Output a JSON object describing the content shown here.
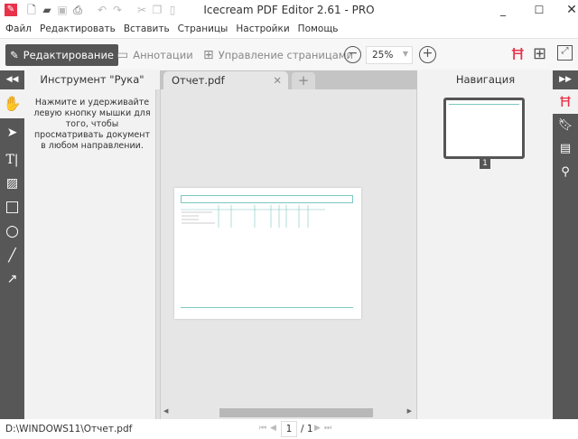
{
  "app": {
    "title": "Icecream PDF Editor 2.61 - PRO",
    "accent": "#e8334a"
  },
  "menu": [
    "Файл",
    "Редактировать",
    "Вставить",
    "Страницы",
    "Настройки",
    "Помощь"
  ],
  "toolbar": {
    "edit": "Редактирование",
    "annot": "Аннотации",
    "pages": "Управление страницами",
    "zoom": "25%"
  },
  "left_panel": {
    "title": "Инструмент \"Рука\"",
    "help": "Нажмите и удерживайте левую кнопку мышки для того, чтобы просматривать документ в любом направлении."
  },
  "tabs": [
    {
      "label": "Отчет.pdf"
    }
  ],
  "right_panel": {
    "title": "Навигация",
    "thumb_page": "1"
  },
  "status": {
    "path": "D:\\WINDOWS11\\Отчет.pdf",
    "page": "1",
    "total": "/ 1"
  }
}
